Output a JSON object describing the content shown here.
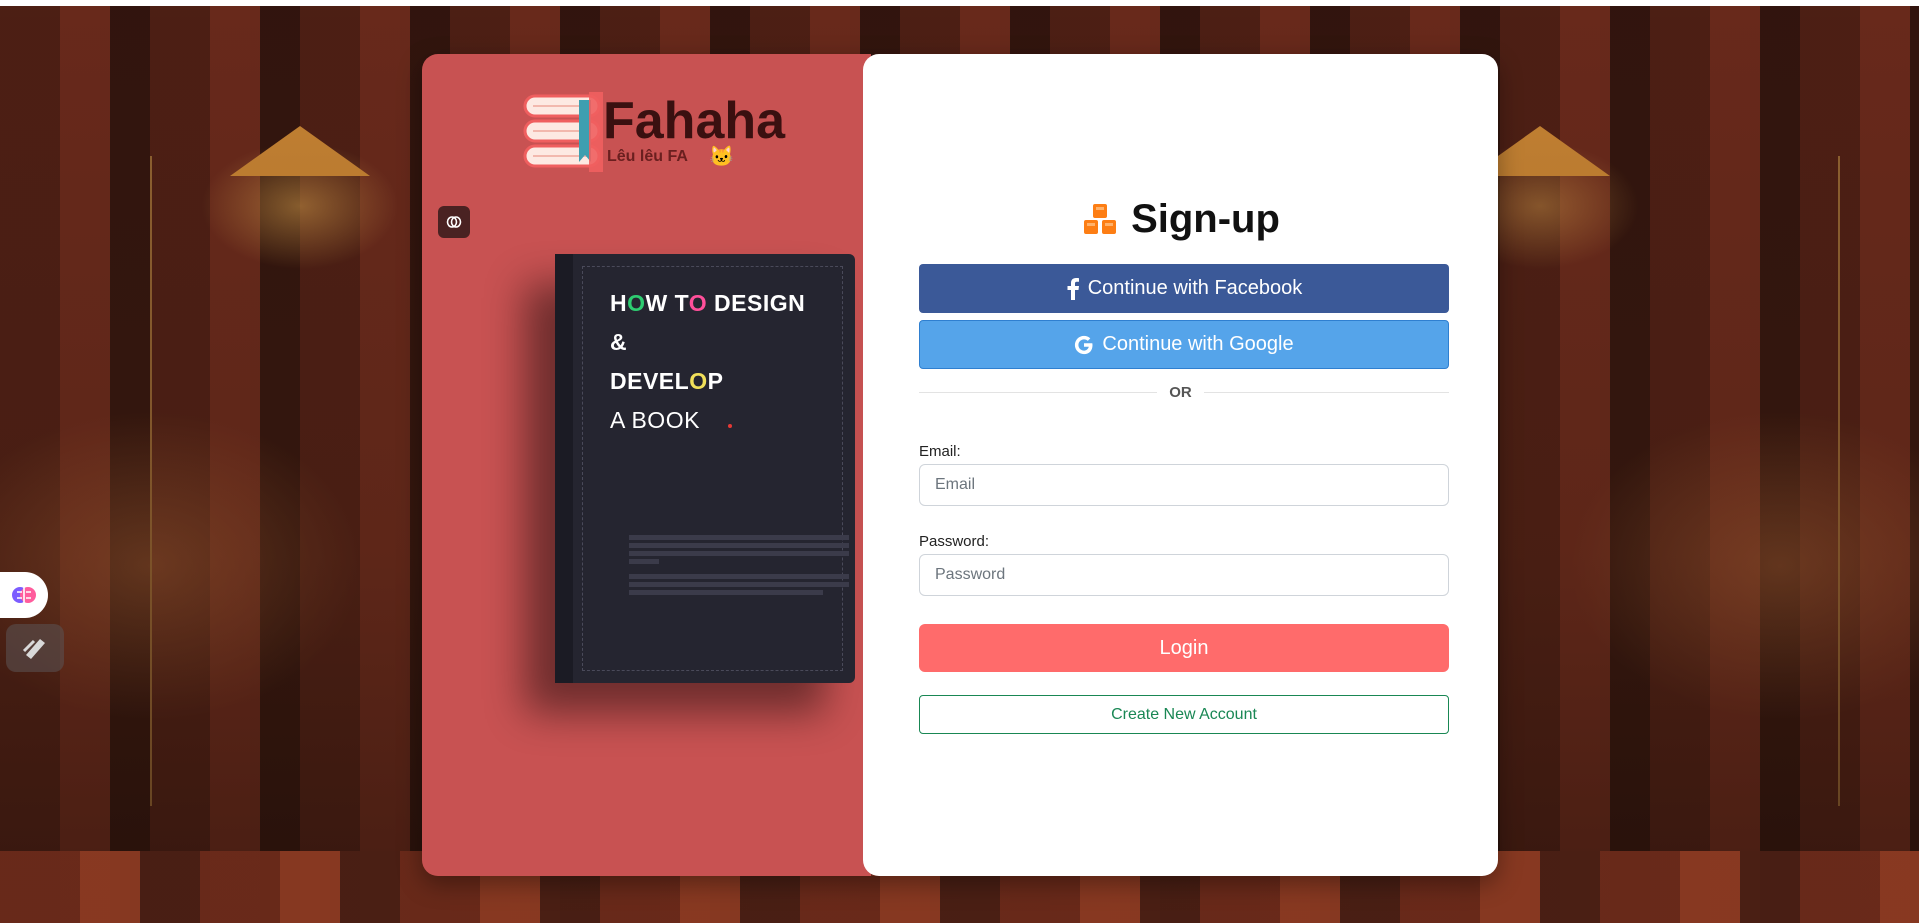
{
  "brand": {
    "name": "Fahaha",
    "tagline": "Lêu lêu FA",
    "emoji": "🐱"
  },
  "book": {
    "line1": [
      "H",
      "O",
      "W T",
      "O",
      " DESIGN"
    ],
    "line2": "&",
    "line3": [
      "DEVEL",
      "O",
      "P"
    ],
    "line4": "A BOOK"
  },
  "signup": {
    "title": "Sign-up",
    "title_icon": "cubes-icon",
    "facebook_label": "Continue with Facebook",
    "google_label": "Continue with Google",
    "divider_label": "OR",
    "email_label": "Email:",
    "email_placeholder": "Email",
    "email_value": "",
    "password_label": "Password:",
    "password_placeholder": "Password",
    "password_value": "",
    "login_label": "Login",
    "create_label": "Create New Account"
  },
  "colors": {
    "left_panel": "#c85252",
    "facebook": "#3b5998",
    "google": "#55a4ea",
    "login": "#ff6b6b",
    "create_border": "#198754",
    "title_icon": "#fd7e14"
  },
  "side_widgets": [
    "brain-icon",
    "pen-icon"
  ]
}
